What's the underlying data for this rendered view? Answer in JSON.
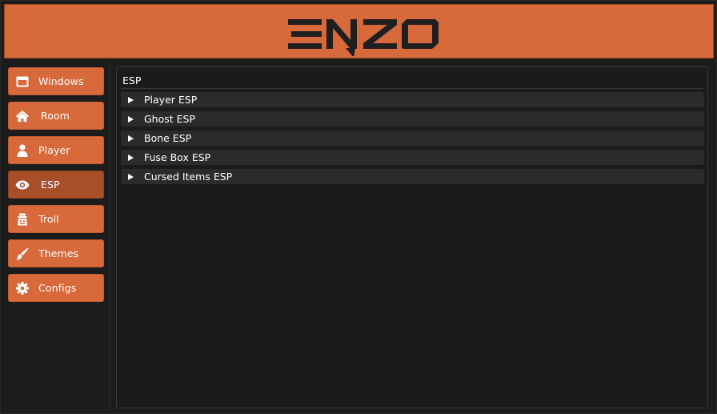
{
  "header": {
    "logo_text": "ENZO"
  },
  "colors": {
    "accent": "#d7693a",
    "accent_active": "#a84f29",
    "background": "#1c1c1c",
    "section_bg": "#2b2b2d",
    "text": "#ffffff"
  },
  "sidebar": {
    "items": [
      {
        "label": "Windows",
        "icon": "window-icon",
        "active": false
      },
      {
        "label": "Room",
        "icon": "home-icon",
        "active": false
      },
      {
        "label": "Player",
        "icon": "user-icon",
        "active": false
      },
      {
        "label": "ESP",
        "icon": "eye-icon",
        "active": true
      },
      {
        "label": "Troll",
        "icon": "troll-icon",
        "active": false
      },
      {
        "label": "Themes",
        "icon": "brush-icon",
        "active": false
      },
      {
        "label": "Configs",
        "icon": "gear-icon",
        "active": false
      }
    ]
  },
  "main": {
    "title": "ESP",
    "sections": [
      {
        "label": "Player ESP",
        "icon": "arrow-right-icon"
      },
      {
        "label": "Ghost ESP",
        "icon": "arrow-right-icon"
      },
      {
        "label": "Bone ESP",
        "icon": "arrow-right-icon"
      },
      {
        "label": "Fuse Box ESP",
        "icon": "arrow-right-icon"
      },
      {
        "label": "Cursed Items ESP",
        "icon": "arrow-right-icon"
      }
    ]
  }
}
